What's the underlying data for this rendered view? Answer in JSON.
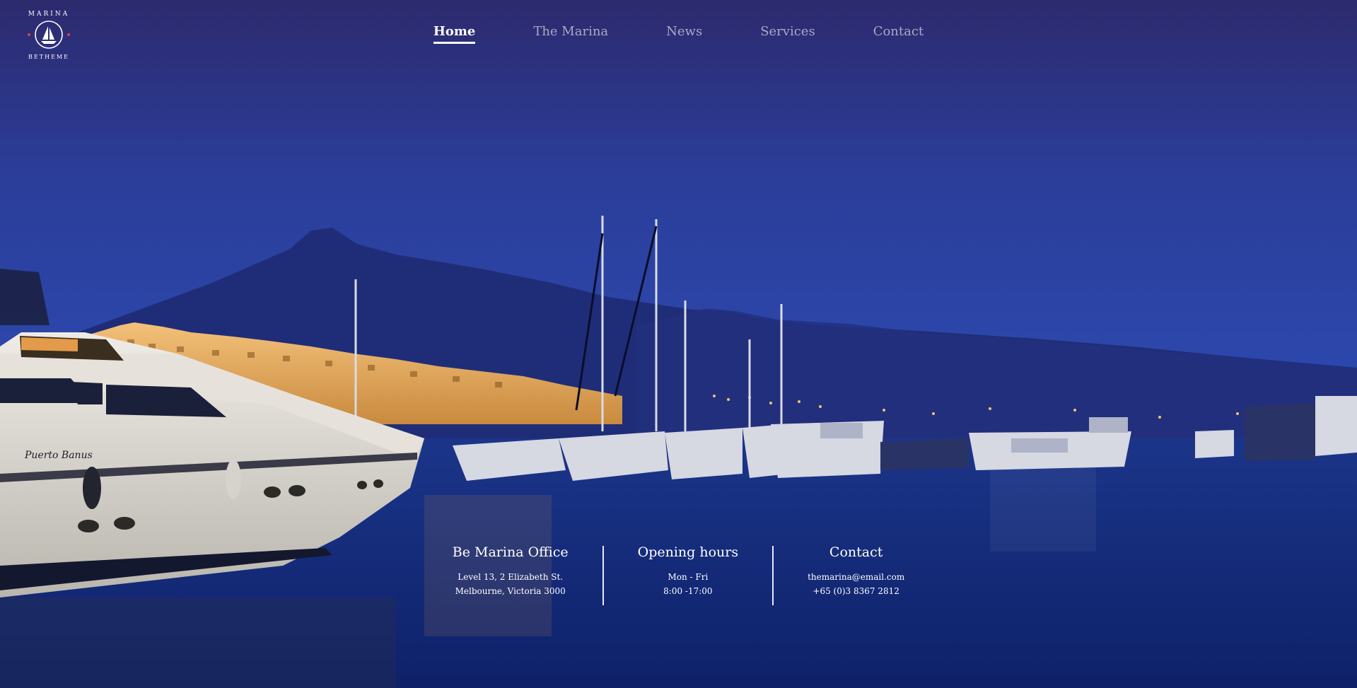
{
  "logo": {
    "top_text": "MARINA",
    "bottom_text": "BETHEME",
    "icon": "sailboat-icon"
  },
  "nav": {
    "items": [
      {
        "label": "Home",
        "active": true
      },
      {
        "label": "The Marina",
        "active": false
      },
      {
        "label": "News",
        "active": false
      },
      {
        "label": "Services",
        "active": false
      },
      {
        "label": "Contact",
        "active": false
      }
    ]
  },
  "info": {
    "office": {
      "title": "Be Marina Office",
      "line1": "Level 13, 2 Elizabeth St.",
      "line2": "Melbourne, Victoria 3000"
    },
    "hours": {
      "title": "Opening hours",
      "line1": "Mon - Fri",
      "line2": "8:00 -17:00"
    },
    "contact": {
      "title": "Contact",
      "line1": "themarina@email.com",
      "line2": "+65 (0)3 8367 2812"
    }
  },
  "yacht_name": "Puerto Banus",
  "colors": {
    "sky_top": "#2d2a6e",
    "sky_mid": "#2c46a8",
    "water": "#122a78",
    "accent_red": "#e0423c"
  }
}
